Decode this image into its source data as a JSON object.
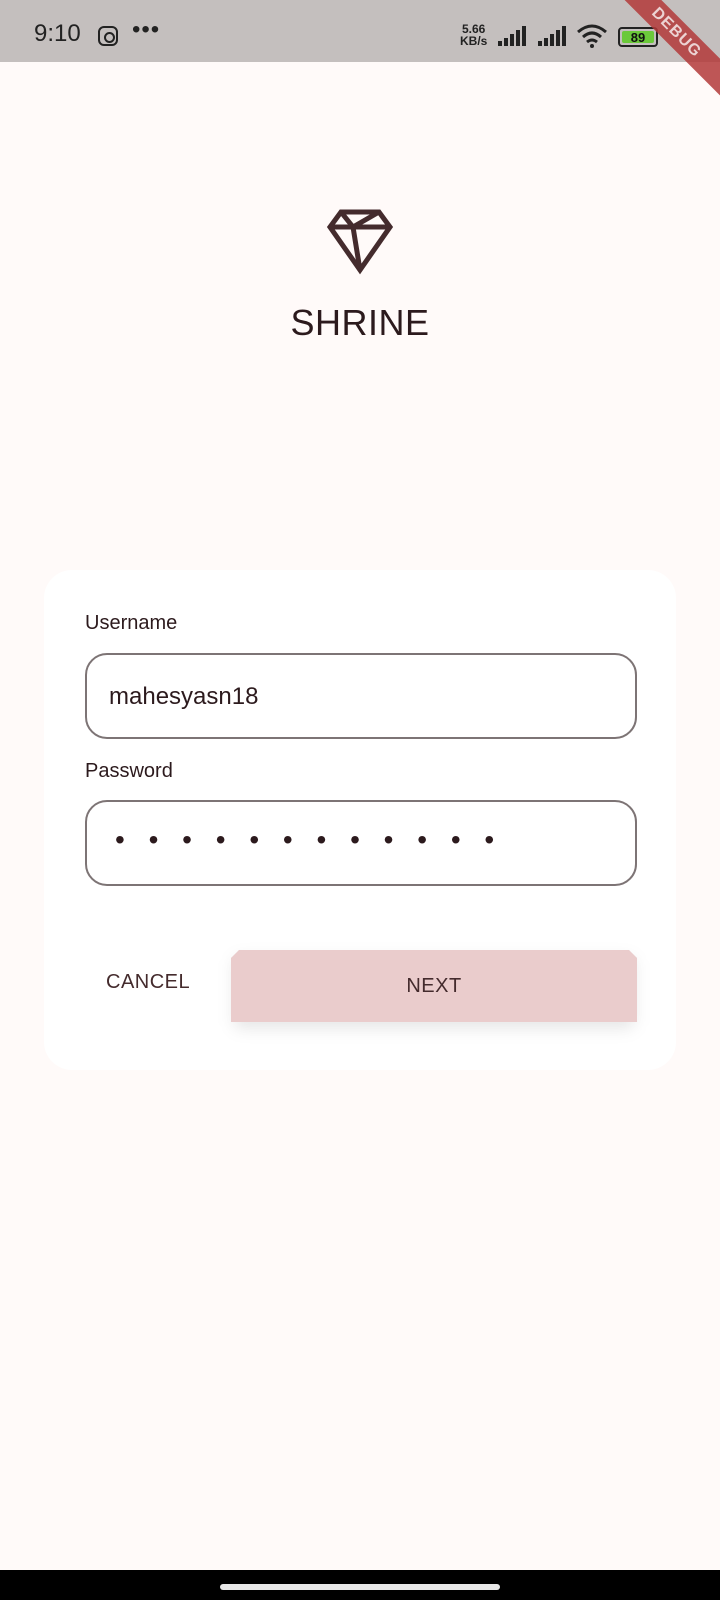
{
  "status_bar": {
    "time": "9:10",
    "overflow": "•••",
    "net_speed_value": "5.66",
    "net_speed_unit": "KB/s",
    "battery": "89",
    "icons": [
      "instagram-icon",
      "signal-icon",
      "wifi-icon",
      "battery-icon"
    ]
  },
  "debug_banner": "DEBUG",
  "brand": {
    "logo": "diamond-icon",
    "name": "SHRINE"
  },
  "form": {
    "username_label": "Username",
    "username_value": "mahesyasn18",
    "password_label": "Password",
    "password_masked": "• • • • • • • • • • • •"
  },
  "actions": {
    "cancel_label": "CANCEL",
    "next_label": "NEXT"
  },
  "colors": {
    "background": "#fffaf9",
    "text": "#2c1a1d",
    "button_bg": "#eacccc",
    "button_text": "#442b2d",
    "status_bar": "#c4bfbe",
    "battery_fill": "#6bc93a"
  }
}
